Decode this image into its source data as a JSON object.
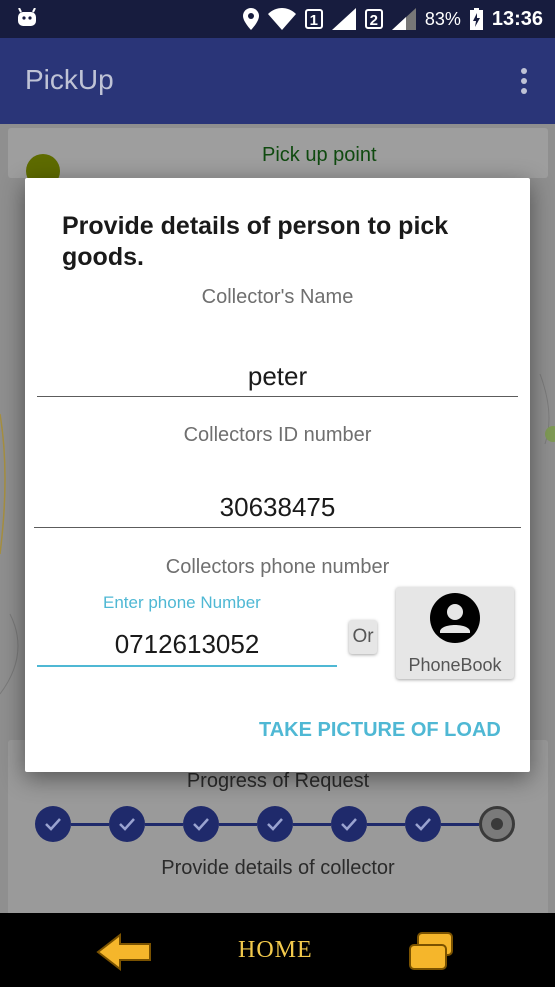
{
  "status_bar": {
    "sim1": "1",
    "sim2": "2",
    "battery": "83%",
    "time": "13:36"
  },
  "app_bar": {
    "title": "PickUp"
  },
  "background": {
    "pickup_label": "Pick up point",
    "progress_title": "Progress of Request",
    "progress_description": "Provide details of collector",
    "progress": {
      "completed_steps": 6,
      "total_steps": 7
    }
  },
  "dialog": {
    "title": "Provide details of person to pick goods.",
    "name_label": "Collector's Name",
    "name_value": "peter",
    "id_label": "Collectors ID number",
    "id_value": "30638475",
    "phone_label": "Collectors phone number",
    "phone_hint": "Enter phone Number",
    "phone_value": "0712613052",
    "or_label": "Or",
    "phonebook_label": "PhoneBook",
    "action_label": "TAKE PICTURE OF LOAD"
  },
  "bottom_nav": {
    "home_label": "HOME"
  },
  "colors": {
    "app_bar": "#2a3578",
    "status_bar": "#171c3e",
    "accent": "#4fb8d4",
    "step": "#1f2a6b",
    "home_text": "#f2c94c"
  }
}
